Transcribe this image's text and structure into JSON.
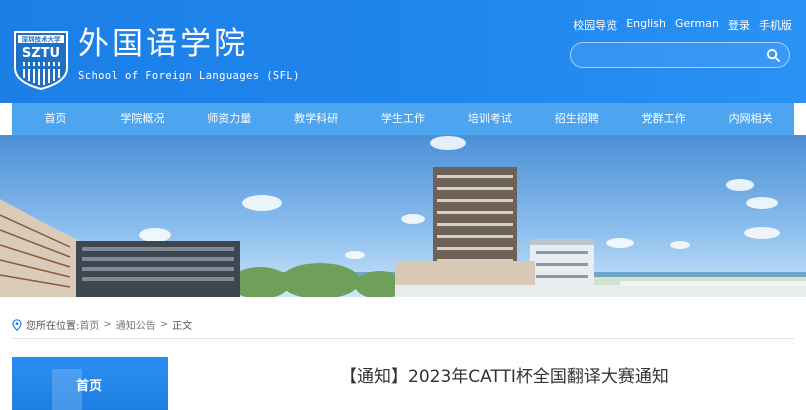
{
  "header": {
    "title": "外国语学院",
    "subtitle": "School of Foreign Languages (SFL)",
    "logo": {
      "badge_text": "深圳技术大学",
      "short_name": "SZTU",
      "primary_color": "#1e6fc6"
    },
    "top_links": [
      "校园导览",
      "English",
      "German",
      "登录",
      "手机版"
    ],
    "search": {
      "placeholder": "",
      "icon": "search-icon"
    }
  },
  "nav": {
    "items": [
      "首页",
      "学院概况",
      "师资力量",
      "教学科研",
      "学生工作",
      "培训考试",
      "招生招聘",
      "党群工作",
      "内网相关"
    ]
  },
  "breadcrumb": {
    "label": "您所在位置:",
    "items": [
      "首页",
      "通知公告",
      "正文"
    ],
    "separator": ">"
  },
  "sidebar": {
    "title": "首页"
  },
  "article": {
    "title": "【通知】2023年CATTI杯全国翻译大赛通知"
  },
  "colors": {
    "header_blue": "#1f86ee",
    "nav_blue": "#4ea5ef",
    "text_dark": "#333333"
  }
}
